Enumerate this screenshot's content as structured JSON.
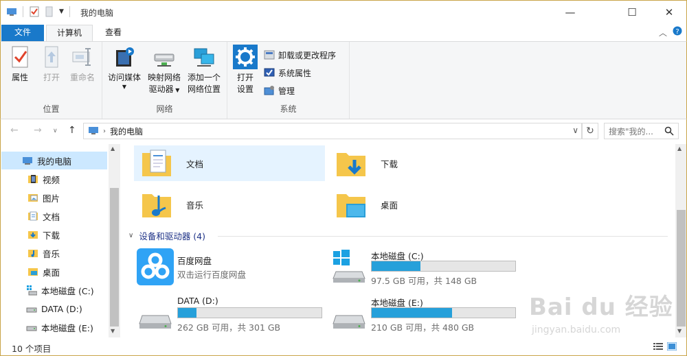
{
  "window": {
    "title": "我的电脑",
    "controls": {
      "minimize": "—",
      "maximize": "☐",
      "close": "✕"
    }
  },
  "ribbon_tabs": [
    {
      "label": "文件"
    },
    {
      "label": "计算机"
    },
    {
      "label": "查看"
    }
  ],
  "ribbon": {
    "groups": [
      {
        "label": "位置"
      },
      {
        "label": "网络"
      },
      {
        "label": "系统"
      }
    ],
    "location": {
      "properties": "属性",
      "open": "打开",
      "rename": "重命名"
    },
    "network": {
      "access_media": "访问媒体",
      "map_drive_line1": "映射网络",
      "map_drive_line2": "驱动器",
      "add_location_line1": "添加一个",
      "add_location_line2": "网络位置"
    },
    "system": {
      "open_settings_line1": "打开",
      "open_settings_line2": "设置",
      "uninstall": "卸载或更改程序",
      "system_properties": "系统属性",
      "manage": "管理"
    }
  },
  "address": {
    "path": "我的电脑",
    "search_placeholder": "搜索\"我的..."
  },
  "sidebar": {
    "items": [
      {
        "label": "我的电脑",
        "icon": "computer"
      },
      {
        "label": "视频",
        "icon": "video"
      },
      {
        "label": "图片",
        "icon": "pictures"
      },
      {
        "label": "文档",
        "icon": "documents"
      },
      {
        "label": "下载",
        "icon": "downloads"
      },
      {
        "label": "音乐",
        "icon": "music"
      },
      {
        "label": "桌面",
        "icon": "desktop"
      },
      {
        "label": "本地磁盘 (C:)",
        "icon": "windows-drive"
      },
      {
        "label": "DATA (D:)",
        "icon": "drive"
      },
      {
        "label": "本地磁盘 (E:)",
        "icon": "drive"
      }
    ]
  },
  "folders": [
    {
      "label": "文档",
      "icon": "documents-folder"
    },
    {
      "label": "下载",
      "icon": "downloads-folder"
    },
    {
      "label": "音乐",
      "icon": "music-folder"
    },
    {
      "label": "桌面",
      "icon": "desktop-folder"
    }
  ],
  "devices_section": {
    "title": "设备和驱动器 (4)"
  },
  "devices": [
    {
      "name": "百度网盘",
      "sub": "双击运行百度网盘",
      "type": "app"
    },
    {
      "name": "本地磁盘 (C:)",
      "sub": "97.5 GB 可用，共 148 GB",
      "used_fraction": 0.34,
      "type": "windows-drive"
    },
    {
      "name": "DATA (D:)",
      "sub": "262 GB 可用，共 301 GB",
      "used_fraction": 0.13,
      "type": "drive"
    },
    {
      "name": "本地磁盘 (E:)",
      "sub": "210 GB 可用，共 480 GB",
      "used_fraction": 0.56,
      "type": "drive"
    }
  ],
  "status": {
    "item_count": "10 个项目"
  },
  "watermark": {
    "brand": "Bai du 经验",
    "url": "jingyan.baidu.com"
  },
  "colors": {
    "accent": "#1979ca",
    "selection": "#cce8ff",
    "bar_fill": "#26a0da",
    "folder": "#f5c64b"
  }
}
